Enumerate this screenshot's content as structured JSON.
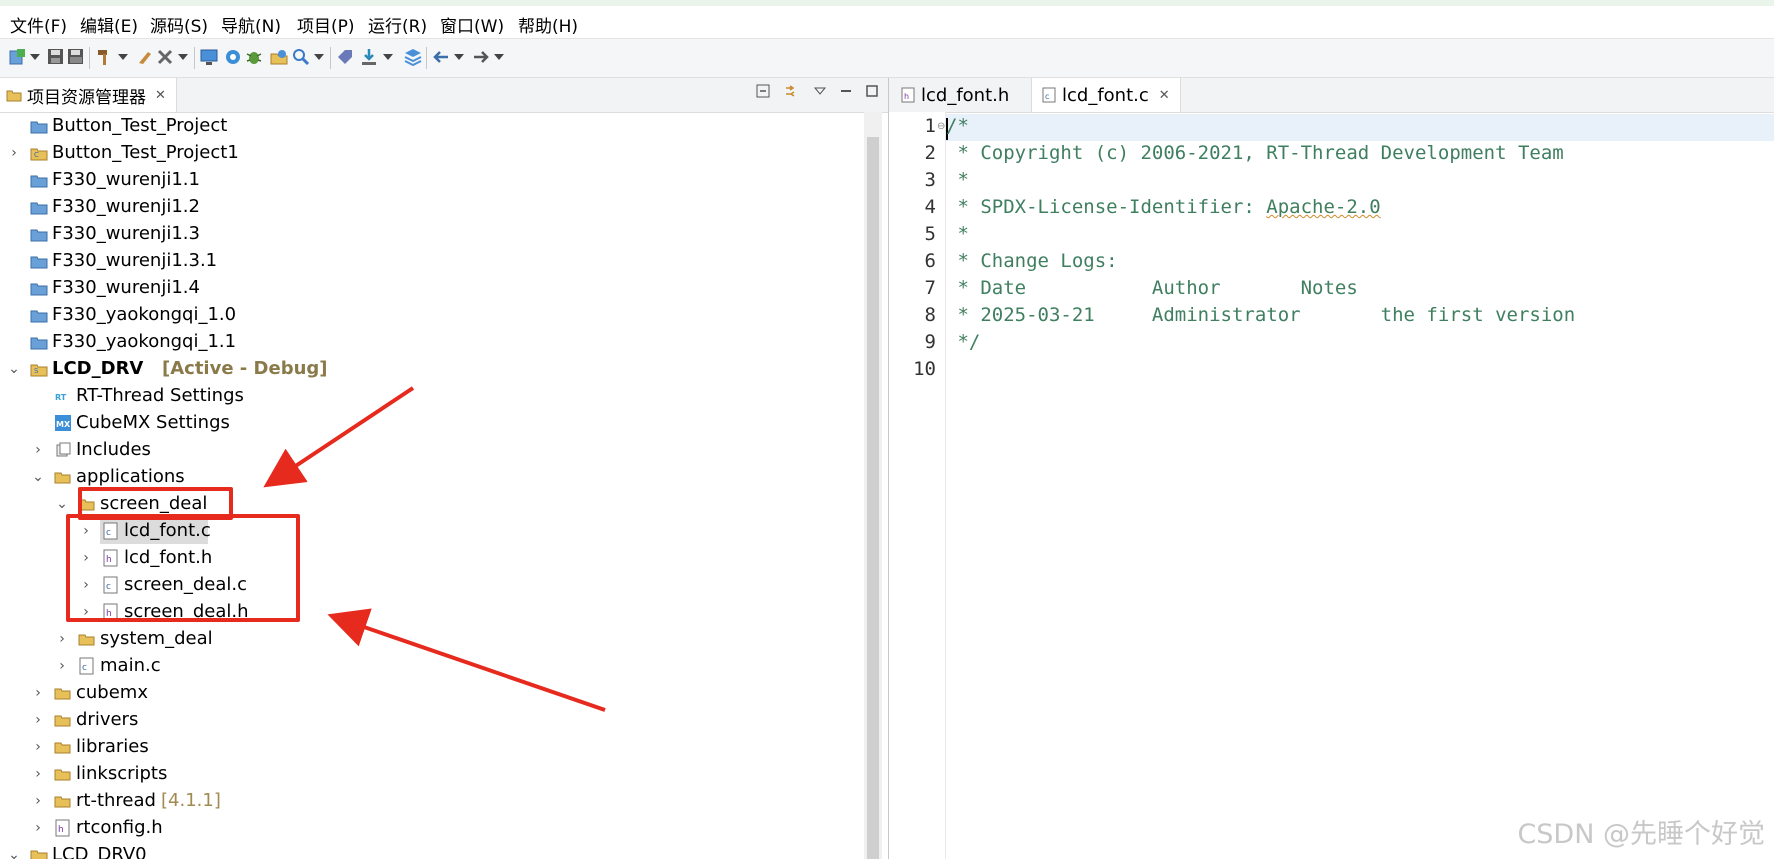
{
  "menubar": {
    "items": [
      "文件(F)",
      "编辑(E)",
      "源码(S)",
      "导航(N)",
      "项目(P)",
      "运行(R)",
      "窗口(W)",
      "帮助(H)"
    ]
  },
  "left_panel": {
    "tab_title": "项目资源管理器",
    "tab_close": "✕"
  },
  "tree": {
    "active_tag": "[Active - Debug]",
    "rtthread_version": "[4.1.1]",
    "items": [
      "Button_Test_Project",
      "Button_Test_Project1",
      "F330_wurenji1.1",
      "F330_wurenji1.2",
      "F330_wurenji1.3",
      "F330_wurenji1.3.1",
      "F330_wurenji1.4",
      "F330_yaokongqi_1.0",
      "F330_yaokongqi_1.1",
      "LCD_DRV",
      "RT-Thread Settings",
      "CubeMX Settings",
      "Includes",
      "applications",
      "screen_deal",
      "lcd_font.c",
      "lcd_font.h",
      "screen_deal.c",
      "screen_deal.h",
      "system_deal",
      "main.c",
      "cubemx",
      "drivers",
      "libraries",
      "linkscripts",
      "rt-thread",
      "rtconfig.h",
      "LCD_DRV0"
    ]
  },
  "editor": {
    "tabs": [
      {
        "label": "lcd_font.h",
        "active": false
      },
      {
        "label": "lcd_font.c",
        "active": true
      }
    ],
    "tab_close": "✕",
    "line_numbers": [
      "1",
      "2",
      "3",
      "4",
      "5",
      "6",
      "7",
      "8",
      "9",
      "10"
    ],
    "lines": [
      "/*",
      " * Copyright (c) 2006-2021, RT-Thread Development Team",
      " *",
      " * SPDX-License-Identifier: ",
      " *",
      " * Change Logs:",
      " * Date           Author       Notes",
      " * 2025-03-21     Administrator       the first version",
      " */",
      ""
    ],
    "license_value": "Apache-2.0"
  },
  "watermark": "CSDN @先睡个好觉",
  "colors": {
    "comment": "#3f7f5f",
    "annotation_red": "#e62a1e",
    "active_tag": "#8a7a4a"
  }
}
